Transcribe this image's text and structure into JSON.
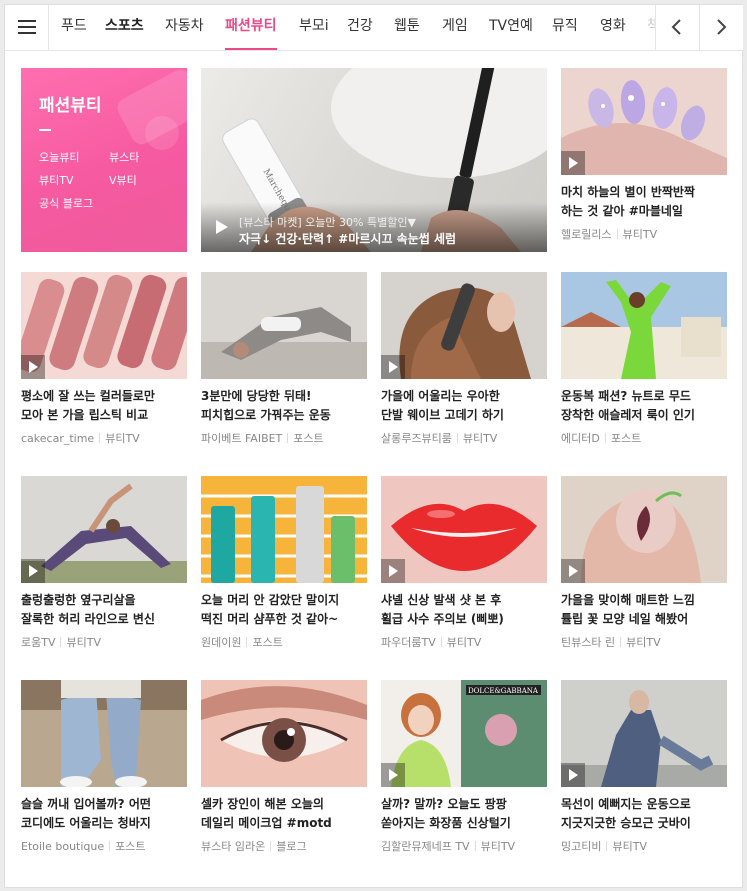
{
  "nav": {
    "tabs": [
      "푸드",
      "스포츠",
      "자동차",
      "패션뷰티",
      "부모i",
      "건강",
      "웹툰",
      "게임",
      "TV연예",
      "뮤직",
      "영화",
      "책"
    ],
    "active_tab": "패션뷰티"
  },
  "featured": {
    "box_title": "패션뷰티",
    "box_links": [
      "오늘뷰티",
      "뷰스타",
      "뷰티TV",
      "V뷰티",
      "공식 블로그"
    ],
    "big_line1": "[뷰스타 마켓] 오늘만 30% 특별할인▼",
    "big_line2": "자극↓ 건강·탄력↑ #마르시끄 속눈썹 세럼",
    "side_title": [
      "마치 하늘의 별이 반짝반짝",
      "하는 것 같아 #마블네일"
    ],
    "side_source": "헬로릴리스",
    "side_channel": "뷰티TV"
  },
  "cards": [
    {
      "title": [
        "평소에 잘 쓰는 컬러들로만",
        "모아 본 가을 립스틱 비교"
      ],
      "source": "cakecar_time",
      "channel": "뷰티TV"
    },
    {
      "title": [
        "3분만에 당당한 뒤태!",
        "피치힙으로 가꿔주는 운동"
      ],
      "source": "파이베트 FAIBET",
      "channel": "포스트"
    },
    {
      "title": [
        "가을에 어울리는 우아한",
        "단발 웨이브 고데기 하기"
      ],
      "source": "살롱루즈뷰티룸",
      "channel": "뷰티TV"
    },
    {
      "title": [
        "운동복 패션? 뉴트로 무드",
        "장착한 애슬레저 룩이 인기"
      ],
      "source": "에디터D",
      "channel": "포스트"
    },
    {
      "title": [
        "출렁출렁한 옆구리살을",
        "잘록한 허리 라인으로 변신"
      ],
      "source": "로움TV",
      "channel": "뷰티TV"
    },
    {
      "title": [
        "오늘 머리 안 감았단 말이지",
        "떡진 머리 샴푸한 것 같아~"
      ],
      "source": "원데이원",
      "channel": "포스트"
    },
    {
      "title": [
        "샤넬 신상 발색 샷 본 후",
        "휠급 사수 주의보 (삐뽀)"
      ],
      "source": "파우더룸TV",
      "channel": "뷰티TV"
    },
    {
      "title": [
        "가을을 맞이해 매트한 느낌",
        "튤립 꽃 모양 네일 해봤어"
      ],
      "source": "틴뷰스타 린",
      "channel": "뷰티TV"
    },
    {
      "title": [
        "슬슬 꺼내 입어볼까? 어떤",
        "코디에도 어울리는 청바지"
      ],
      "source": "Etoile boutique",
      "channel": "포스트"
    },
    {
      "title": [
        "셀카 장인이 해본 오늘의",
        "데일리 메이크업 #motd"
      ],
      "source": "뷰스타 임라온",
      "channel": "블로그"
    },
    {
      "title": [
        "살까? 말까? 오늘도 팡팡",
        "쏟아지는 화장품 신상털기"
      ],
      "source": "김할란뮤제네프 TV",
      "channel": "뷰티TV"
    },
    {
      "title": [
        "목선이 예뻐지는 운동으로",
        "지긋지긋한 승모근 굿바이"
      ],
      "source": "밍고티비",
      "channel": "뷰티TV"
    }
  ],
  "colors": {
    "accent": "#e84a87",
    "pink_box": "#f65aa0"
  },
  "icons": [
    "menu-icon",
    "chevron-left-icon",
    "chevron-right-icon",
    "play-icon"
  ]
}
